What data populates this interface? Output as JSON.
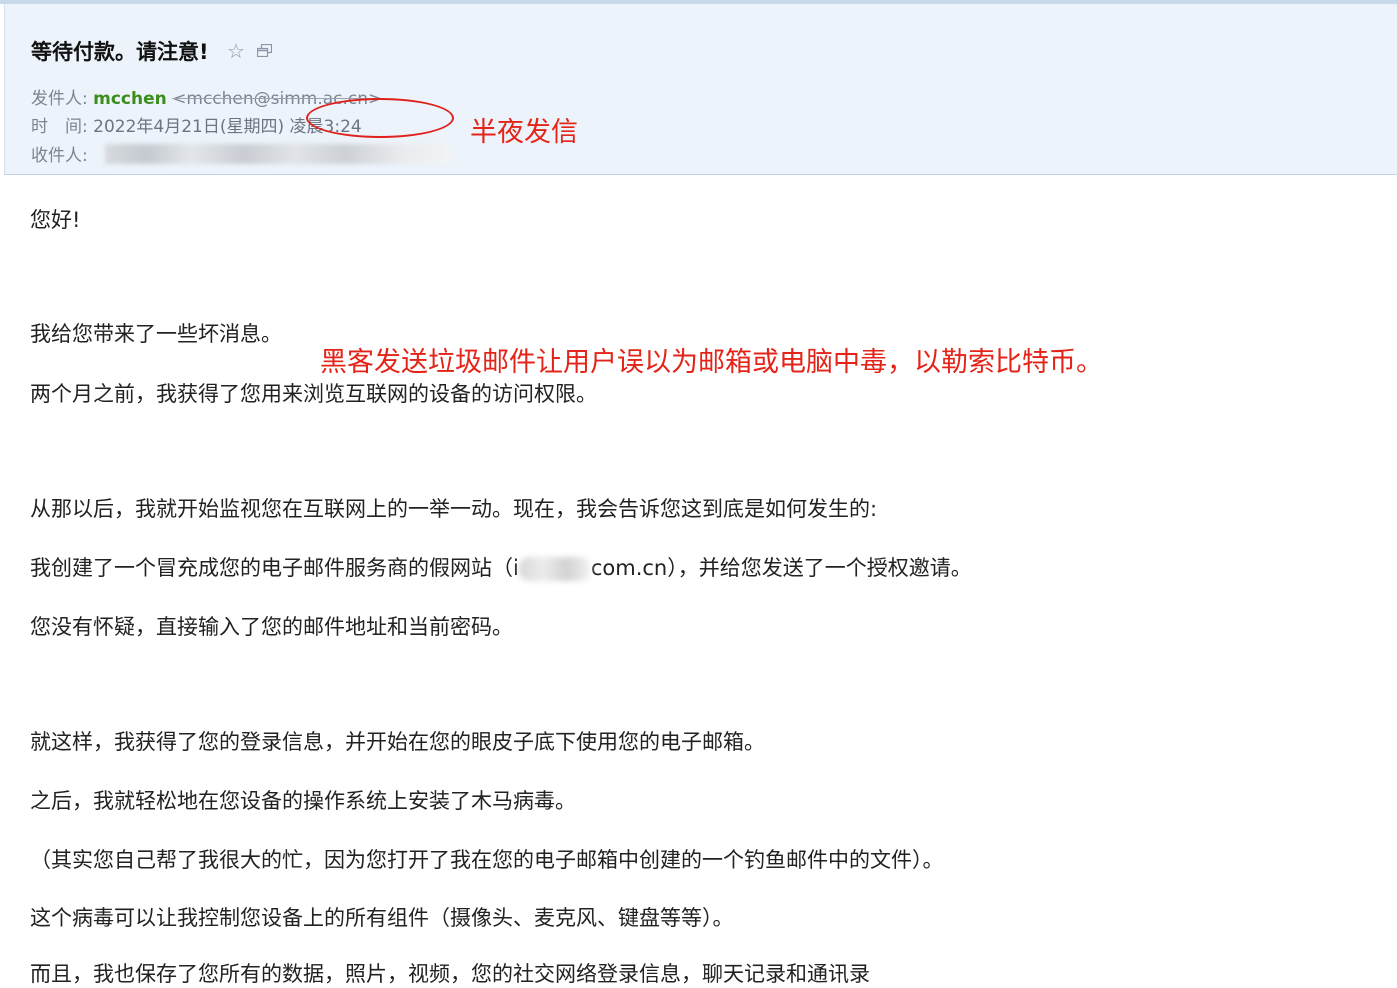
{
  "email": {
    "subject": "等待付款。请注意!",
    "icons": {
      "star": "star-outline-icon",
      "popout": "popout-window-icon"
    },
    "from_label": "发件人:",
    "sender_name": "mcchen",
    "sender_email": "<mcchen@simm.ac.cn>",
    "time_label": "时　间:",
    "time_value": "2022年4月21日(星期四) 凌晨3:24",
    "to_label": "收件人:"
  },
  "annotations": {
    "midnight": "半夜发信",
    "hacker": "黑客发送垃圾邮件让用户误以为邮箱或电脑中毒，以勒索比特币。",
    "color": "#e42418"
  },
  "body": {
    "greeting": "您好!",
    "line1": "我给您带来了一些坏消息。",
    "line2": "两个月之前，我获得了您用来浏览互联网的设备的访问权限。",
    "line3": "从那以后，我就开始监视您在互联网上的一举一动。现在，我会告诉您这到底是如何发生的:",
    "line4_before": "我创建了一个冒充成您的电子邮件服务商的假网站（i",
    "line4_after": "com.cn），并给您发送了一个授权邀请。",
    "line5": "您没有怀疑，直接输入了您的邮件地址和当前密码。",
    "line6": "就这样，我获得了您的登录信息，并开始在您的眼皮子底下使用您的电子邮箱。",
    "line7": "之后，我就轻松地在您设备的操作系统上安装了木马病毒。",
    "line8": "（其实您自己帮了我很大的忙，因为您打开了我在您的电子邮箱中创建的一个钓鱼邮件中的文件）。",
    "line9": "这个病毒可以让我控制您设备上的所有组件（摄像头、麦克风、键盘等等）。",
    "line10": "而且，我也保存了您所有的数据，照片，视频，您的社交网络登录信息，聊天记录和通讯录"
  }
}
